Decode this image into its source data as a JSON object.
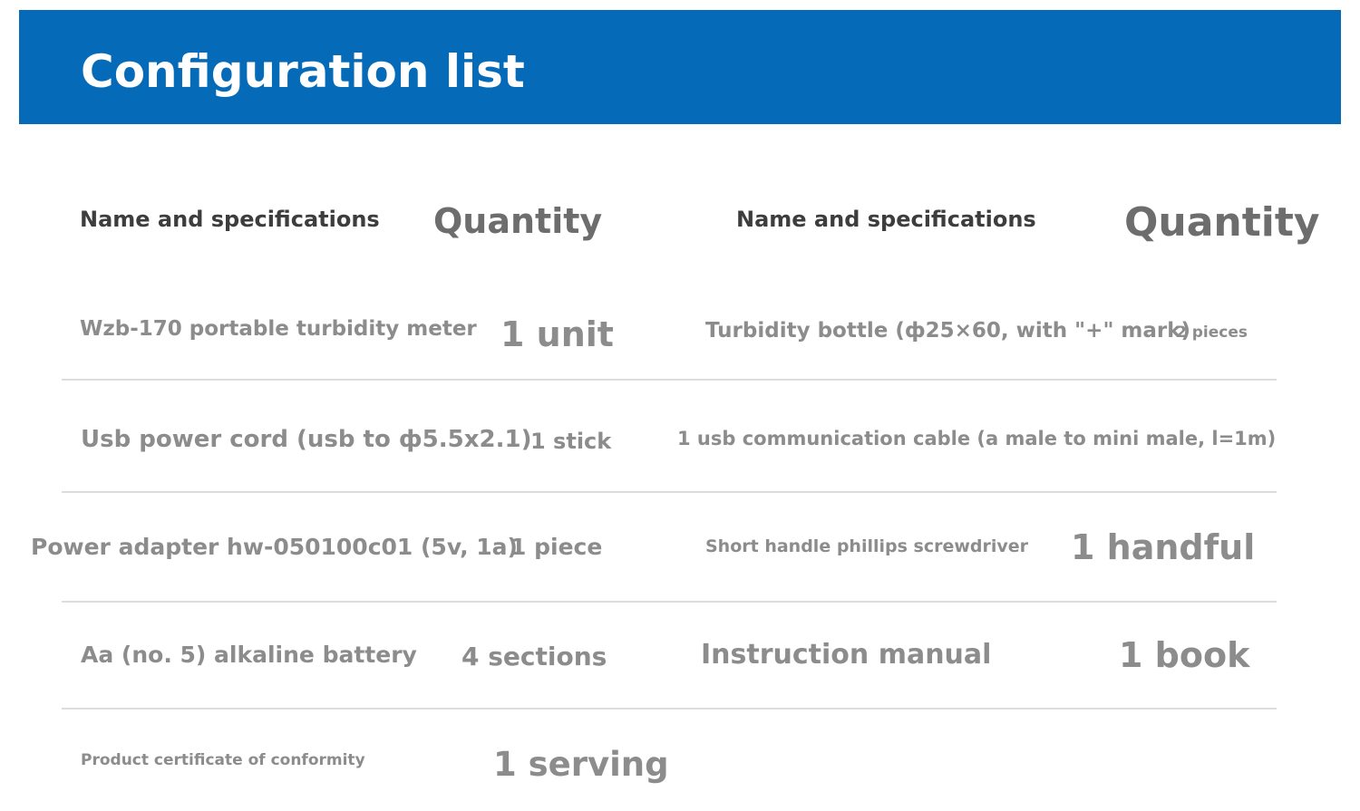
{
  "title": "Configuration list",
  "headers": {
    "name_left": "Name and specifications",
    "qty_left": "Quantity",
    "name_right": "Name and specifications",
    "qty_right": "Quantity"
  },
  "rows": [
    {
      "left_name": "Wzb-170 portable turbidity meter",
      "left_qty": "1 unit",
      "right_name": "Turbidity bottle (ф25×60, with \"+\" mark)",
      "right_qty": "2 pieces"
    },
    {
      "left_name": "Usb power cord (usb to ф5.5x2.1)",
      "left_qty": "1 stick",
      "right_name": "1 usb communication cable (a male to mini male, l=1m)",
      "right_qty": ""
    },
    {
      "left_name": "Power adapter hw-050100c01 (5v, 1a)",
      "left_qty": "1 piece",
      "right_name": "Short handle phillips screwdriver",
      "right_qty": "1 handful"
    },
    {
      "left_name": "Aa (no. 5) alkaline battery",
      "left_qty": "4 sections",
      "right_name": "Instruction manual",
      "right_qty": "1 book"
    },
    {
      "left_name": "Product certificate of conformity",
      "left_qty": "1 serving",
      "right_name": "",
      "right_qty": ""
    }
  ],
  "colors": {
    "banner": "#056ab7",
    "banner_text": "#ffffff",
    "header_name_text": "#3d3d3d",
    "header_qty_text": "#6d6d6d",
    "body_text": "#8c8c8c",
    "divider": "#dddddd"
  }
}
